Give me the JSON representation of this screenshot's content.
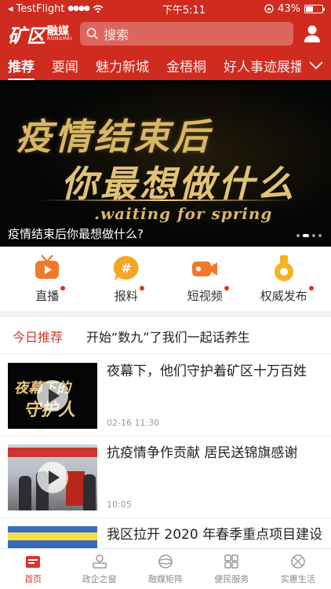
{
  "status_bar": {
    "carrier": "TestFlight",
    "time": "下午5:11",
    "battery": "43%",
    "battery_level": 0.43
  },
  "header": {
    "logo_main": "矿区",
    "logo_name": "融媒",
    "logo_sub": "RONGMEI",
    "search_placeholder": "搜索",
    "icons": {
      "search": "search-icon",
      "user": "user-icon"
    }
  },
  "tabs": [
    "推荐",
    "要闻",
    "魅力新城",
    "金梧桐",
    "好人事迹展播"
  ],
  "active_tab": "推荐",
  "banner": {
    "line1": "疫情结束后",
    "line2": "你最想做什么",
    "line3": ".waiting for spring",
    "caption": "疫情结束后你最想做什么?",
    "slide_count": 4,
    "active_slide": 1
  },
  "quick_entries": [
    {
      "label": "直播",
      "icon": "tv-icon",
      "color": "#f07a2a",
      "badge": true
    },
    {
      "label": "报料",
      "icon": "hash-icon",
      "color": "#f5a623",
      "badge": true
    },
    {
      "label": "短视频",
      "icon": "video-camera-icon",
      "color": "#f07a2a",
      "badge": true
    },
    {
      "label": "权威发布",
      "icon": "medal-icon",
      "color": "#f5b120",
      "badge": true
    }
  ],
  "today": {
    "tag": "今日推荐",
    "headline": "开始“数九”了我们一起话养生"
  },
  "news": [
    {
      "title": "夜幕下，他们守护着矿区十万百姓",
      "time": "02-16 11:30",
      "thumb_text_1": "夜幕下的",
      "thumb_text_2": "守护人"
    },
    {
      "title": "抗疫情争作贡献 居民送锦旗感谢",
      "time": "10:05"
    },
    {
      "title": "我区拉开 2020 年春季重点项目建设"
    }
  ],
  "bottom_nav": [
    {
      "label": "首页",
      "icon": "home-icon",
      "active": true
    },
    {
      "label": "政企之窗",
      "icon": "government-icon",
      "active": false
    },
    {
      "label": "融媒矩阵",
      "icon": "globe-icon",
      "active": false
    },
    {
      "label": "便民服务",
      "icon": "grid-icon",
      "active": false
    },
    {
      "label": "实惠生活",
      "icon": "shop-icon",
      "active": false
    }
  ],
  "colors": {
    "brand_red": "#cf2b1f",
    "accent_red": "#d23a2e",
    "gold": "#d8b765"
  }
}
